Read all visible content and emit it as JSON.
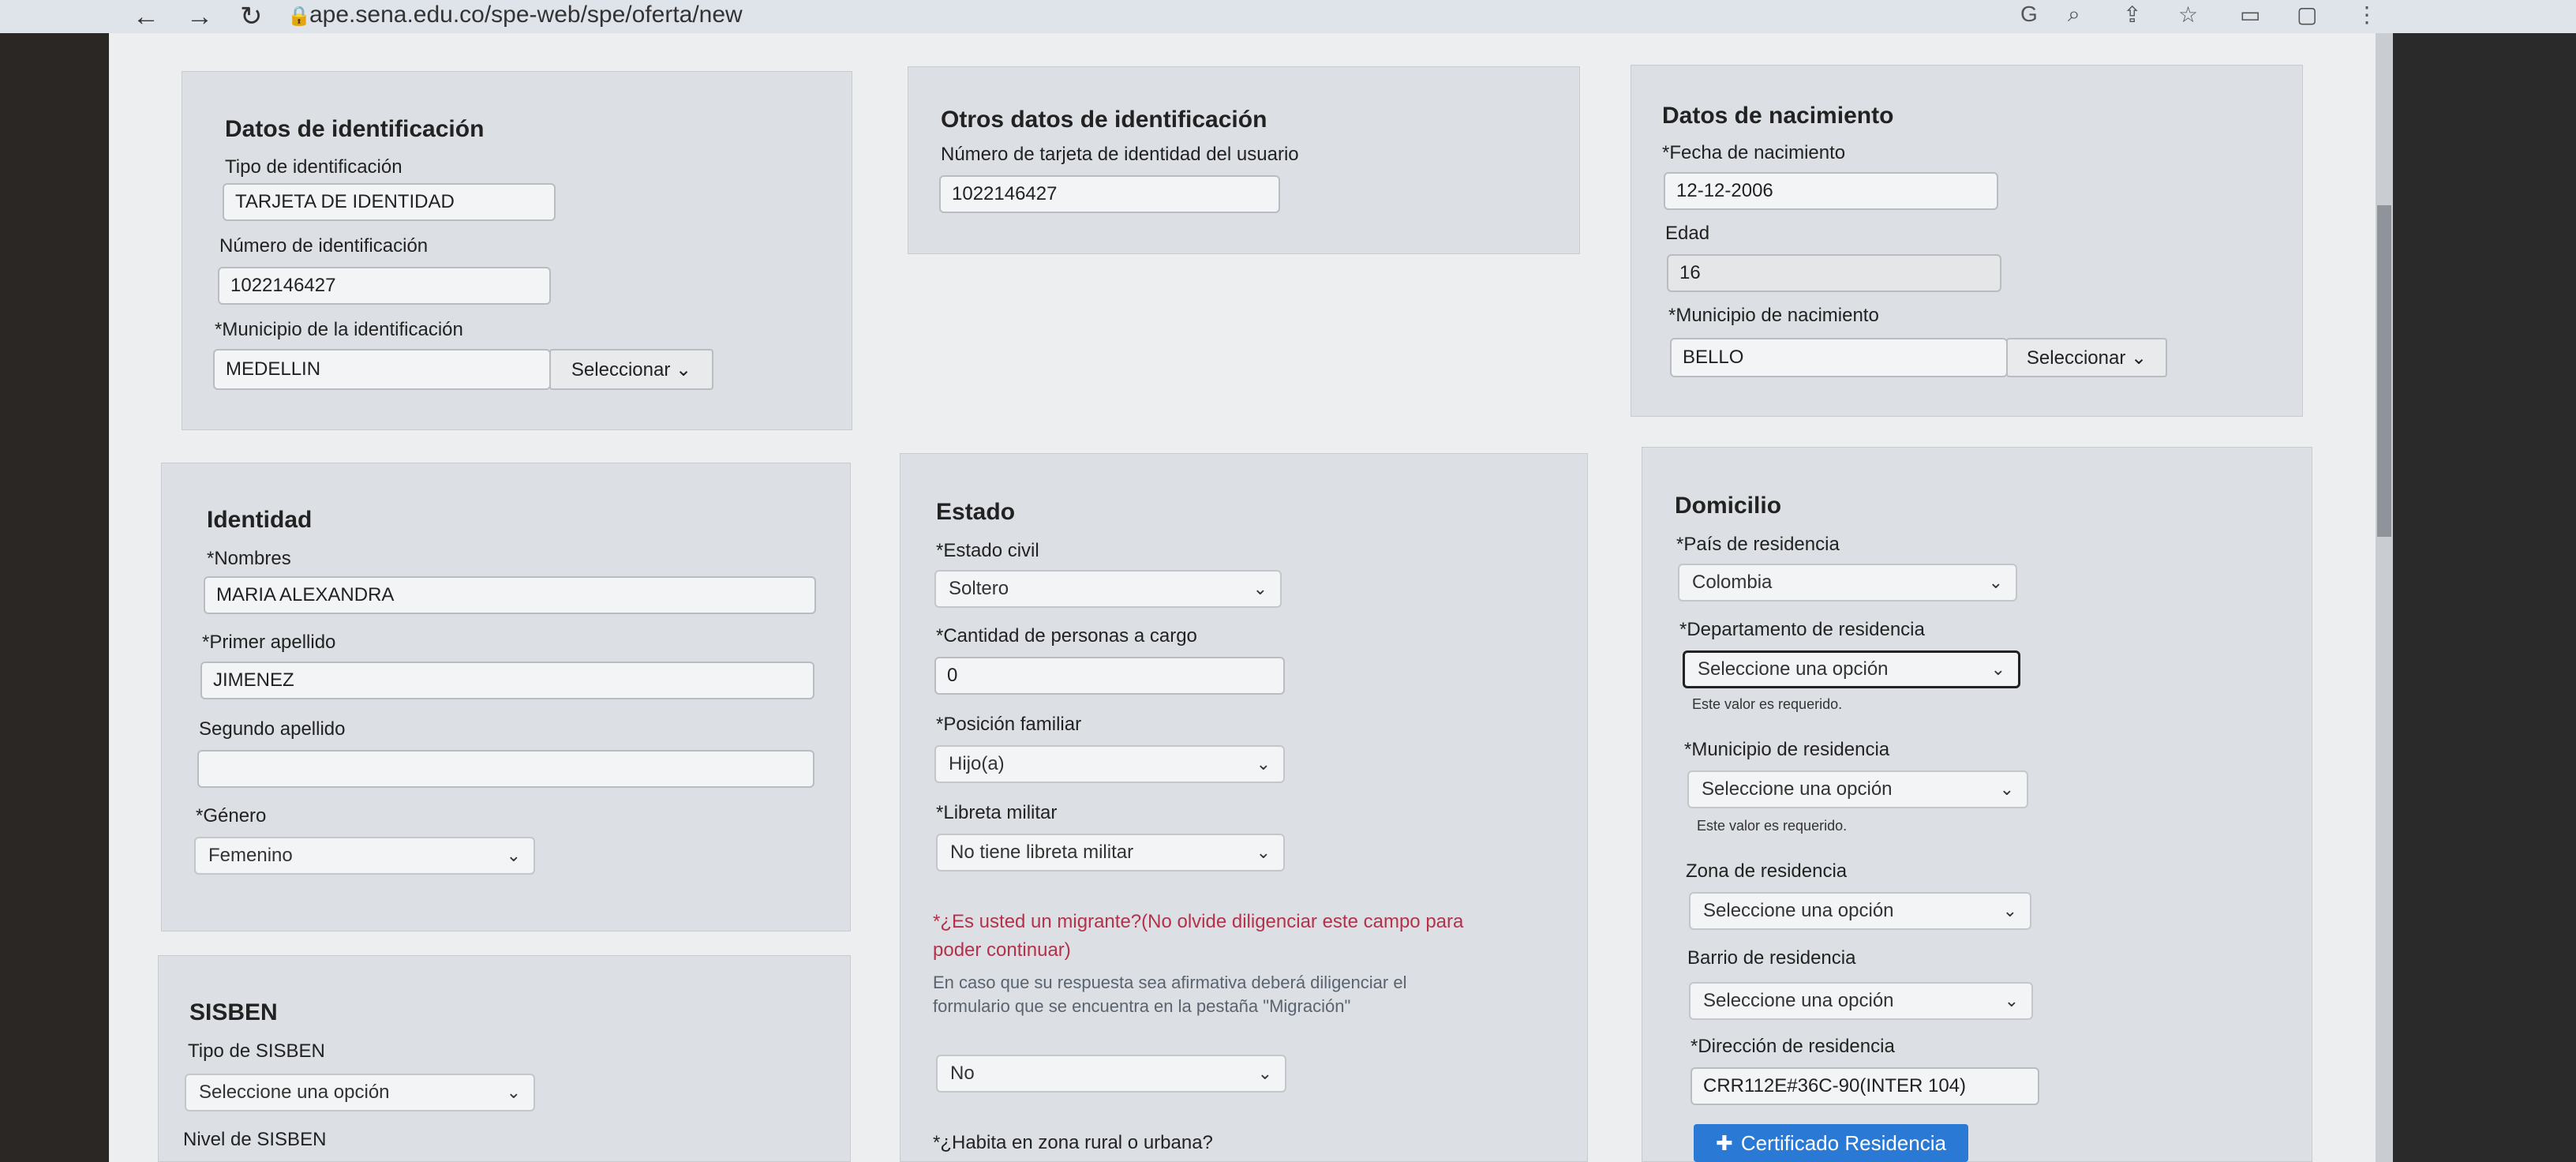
{
  "browser": {
    "url": "ape.sena.edu.co/spe-web/spe/oferta/new"
  },
  "datos_identificacion": {
    "title": "Datos de identificación",
    "tipo_label": "Tipo de identificación",
    "tipo_value": "TARJETA DE IDENTIDAD",
    "numero_label": "Número de identificación",
    "numero_value": "1022146427",
    "municipio_label": "*Municipio de la identificación",
    "municipio_value": "MEDELLIN",
    "seleccionar": "Seleccionar ⌄"
  },
  "otros_datos": {
    "title": "Otros datos de identificación",
    "tarjeta_label": "Número de tarjeta de identidad del usuario",
    "tarjeta_value": "1022146427"
  },
  "nacimiento": {
    "title": "Datos de nacimiento",
    "fecha_label": "*Fecha de nacimiento",
    "fecha_value": "12-12-2006",
    "edad_label": "Edad",
    "edad_value": "16",
    "municipio_label": "*Municipio de nacimiento",
    "municipio_value": "BELLO",
    "seleccionar": "Seleccionar ⌄"
  },
  "identidad": {
    "title": "Identidad",
    "nombres_label": "*Nombres",
    "nombres_value": "MARIA ALEXANDRA",
    "primer_label": "*Primer apellido",
    "primer_value": "JIMENEZ",
    "segundo_label": "Segundo apellido",
    "segundo_value": "",
    "genero_label": "*Género",
    "genero_value": "Femenino"
  },
  "estado": {
    "title": "Estado",
    "civil_label": "*Estado civil",
    "civil_value": "Soltero",
    "cargo_label": "*Cantidad de personas a cargo",
    "cargo_value": "0",
    "posicion_label": "*Posición familiar",
    "posicion_value": "Hijo(a)",
    "libreta_label": "*Libreta militar",
    "libreta_value": "No tiene libreta militar",
    "migrante_q1": "*¿Es usted un migrante?(No olvide diligenciar este campo para",
    "migrante_q2": "poder continuar)",
    "migrante_note1": "En caso que su respuesta sea afirmativa deberá diligenciar el",
    "migrante_note2": "formulario que se encuentra en la pestaña \"Migración\"",
    "migrante_value": "No",
    "rural_label": "*¿Habita en zona rural o urbana?"
  },
  "domicilio": {
    "title": "Domicilio",
    "pais_label": "*País de residencia",
    "pais_value": "Colombia",
    "depto_label": "*Departamento de residencia",
    "depto_value": "Seleccione una opción",
    "depto_error": "Este valor es requerido.",
    "municipio_label": "*Municipio de residencia",
    "municipio_value": "Seleccione una opción",
    "municipio_error": "Este valor es requerido.",
    "zona_label": "Zona de residencia",
    "zona_value": "Seleccione una opción",
    "barrio_label": "Barrio de residencia",
    "barrio_value": "Seleccione una opción",
    "direccion_label": "*Dirección de residencia",
    "direccion_value": "CRR112E#36C-90(INTER 104)",
    "certificado_btn": "Certificado Residencia"
  },
  "sisben": {
    "title": "SISBEN",
    "tipo_label": "Tipo de SISBEN",
    "tipo_value": "Seleccione una opción",
    "nivel_label": "Nivel de SISBEN"
  },
  "icons": [
    "back-arrow-icon",
    "forward-arrow-icon",
    "reload-icon",
    "lock-icon",
    "chevron-down-icon",
    "plus-icon"
  ]
}
